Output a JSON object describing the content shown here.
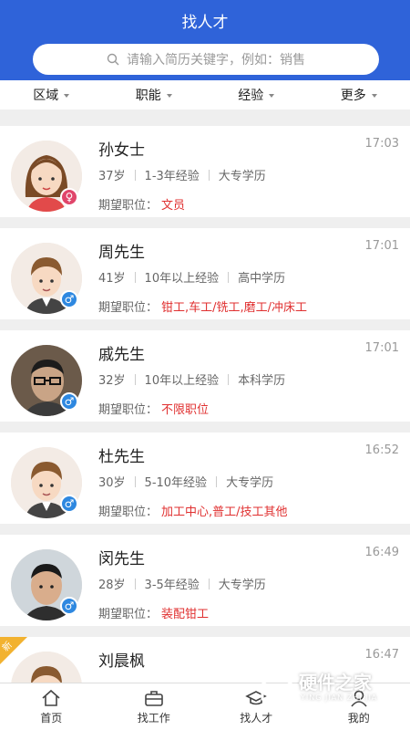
{
  "header": {
    "title": "找人才"
  },
  "search": {
    "placeholder": "请输入简历关键字，例如：销售"
  },
  "filters": [
    "区域",
    "职能",
    "经验",
    "更多"
  ],
  "job_label": "期望职位：",
  "candidates": [
    {
      "name": "孙女士",
      "time": "17:03",
      "age": "37岁",
      "experience": "1-3年经验",
      "education": "大专学历",
      "job": "文员",
      "gender": "female",
      "avatar": "female-cartoon-avatar"
    },
    {
      "name": "周先生",
      "time": "17:01",
      "age": "41岁",
      "experience": "10年以上经验",
      "education": "高中学历",
      "job": "钳工,车工/铣工,磨工/冲床工",
      "gender": "male",
      "avatar": "male-cartoon-avatar"
    },
    {
      "name": "戚先生",
      "time": "17:01",
      "age": "32岁",
      "experience": "10年以上经验",
      "education": "本科学历",
      "job": "不限职位",
      "gender": "male",
      "avatar": "photo-avatar"
    },
    {
      "name": "杜先生",
      "time": "16:52",
      "age": "30岁",
      "experience": "5-10年经验",
      "education": "大专学历",
      "job": "加工中心,普工/技工其他",
      "gender": "male",
      "avatar": "male-cartoon-avatar"
    },
    {
      "name": "闵先生",
      "time": "16:49",
      "age": "28岁",
      "experience": "3-5年经验",
      "education": "大专学历",
      "job": "装配钳工",
      "gender": "male",
      "avatar": "photo-avatar"
    },
    {
      "name": "刘晨枫",
      "time": "16:47",
      "badge": "新",
      "gender": "male",
      "avatar": "male-cartoon-avatar"
    }
  ],
  "tabbar": [
    {
      "label": "首页",
      "icon": "home-icon"
    },
    {
      "label": "找工作",
      "icon": "briefcase-icon"
    },
    {
      "label": "找人才",
      "icon": "graduation-cap-icon"
    },
    {
      "label": "我的",
      "icon": "user-icon"
    }
  ],
  "watermark": {
    "main": "硬件之家",
    "sub": "YING JIAN ZHI JIA"
  }
}
